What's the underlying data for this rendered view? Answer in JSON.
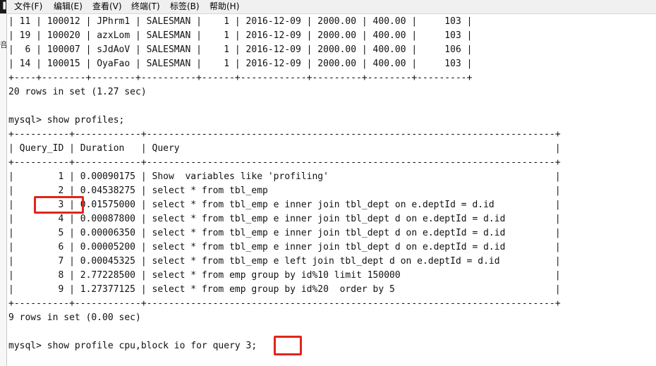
{
  "app_icon": "▐",
  "menu": [
    {
      "key": "file",
      "label": "文件(F)"
    },
    {
      "key": "edit",
      "label": "编辑(E)"
    },
    {
      "key": "view",
      "label": "查看(V)"
    },
    {
      "key": "terminal",
      "label": "终端(T)"
    },
    {
      "key": "tabs",
      "label": "标签(B)"
    },
    {
      "key": "help",
      "label": "帮助(H)"
    }
  ],
  "gutter_glyph": "咅",
  "terminal_lines": [
    "| 11 | 100012 | JPhrm1 | SALESMAN |    1 | 2016-12-09 | 2000.00 | 400.00 |     103 |",
    "| 19 | 100020 | azxLom | SALESMAN |    1 | 2016-12-09 | 2000.00 | 400.00 |     103 |",
    "|  6 | 100007 | sJdAoV | SALESMAN |    1 | 2016-12-09 | 2000.00 | 400.00 |     106 |",
    "| 14 | 100015 | OyaFao | SALESMAN |    1 | 2016-12-09 | 2000.00 | 400.00 |     103 |",
    "+----+--------+--------+----------+------+------------+---------+--------+---------+",
    "20 rows in set (1.27 sec)",
    "",
    "mysql> show profiles;",
    "+----------+------------+--------------------------------------------------------------------------+",
    "| Query_ID | Duration   | Query                                                                    |",
    "+----------+------------+--------------------------------------------------------------------------+",
    "|        1 | 0.00090175 | Show  variables like 'profiling'                                         |",
    "|        2 | 0.04538275 | select * from tbl_emp                                                    |",
    "|        3 | 0.01575000 | select * from tbl_emp e inner join tbl_dept on e.deptId = d.id           |",
    "|        4 | 0.00087800 | select * from tbl_emp e inner join tbl_dept d on e.deptId = d.id         |",
    "|        5 | 0.00006350 | select * from tbl_emp e inner join tbl_dept d on e.deptId = d.id         |",
    "|        6 | 0.00005200 | select * from tbl_emp e inner join tbl_dept d on e.deptId = d.id         |",
    "|        7 | 0.00045325 | select * from tbl_emp e left join tbl_dept d on e.deptId = d.id          |",
    "|        8 | 2.77228500 | select * from emp group by id%10 limit 150000                            |",
    "|        9 | 1.27377125 | select * from emp group by id%20  order by 5                             |",
    "+----------+------------+--------------------------------------------------------------------------+",
    "9 rows in set (0.00 sec)",
    "",
    "mysql> show profile cpu,block io for query 3;"
  ],
  "colors": {
    "highlight": "#e0261b",
    "menubar_bg": "#f0f0f0",
    "terminal_bg": "#ffffff",
    "terminal_fg": "#111111"
  }
}
